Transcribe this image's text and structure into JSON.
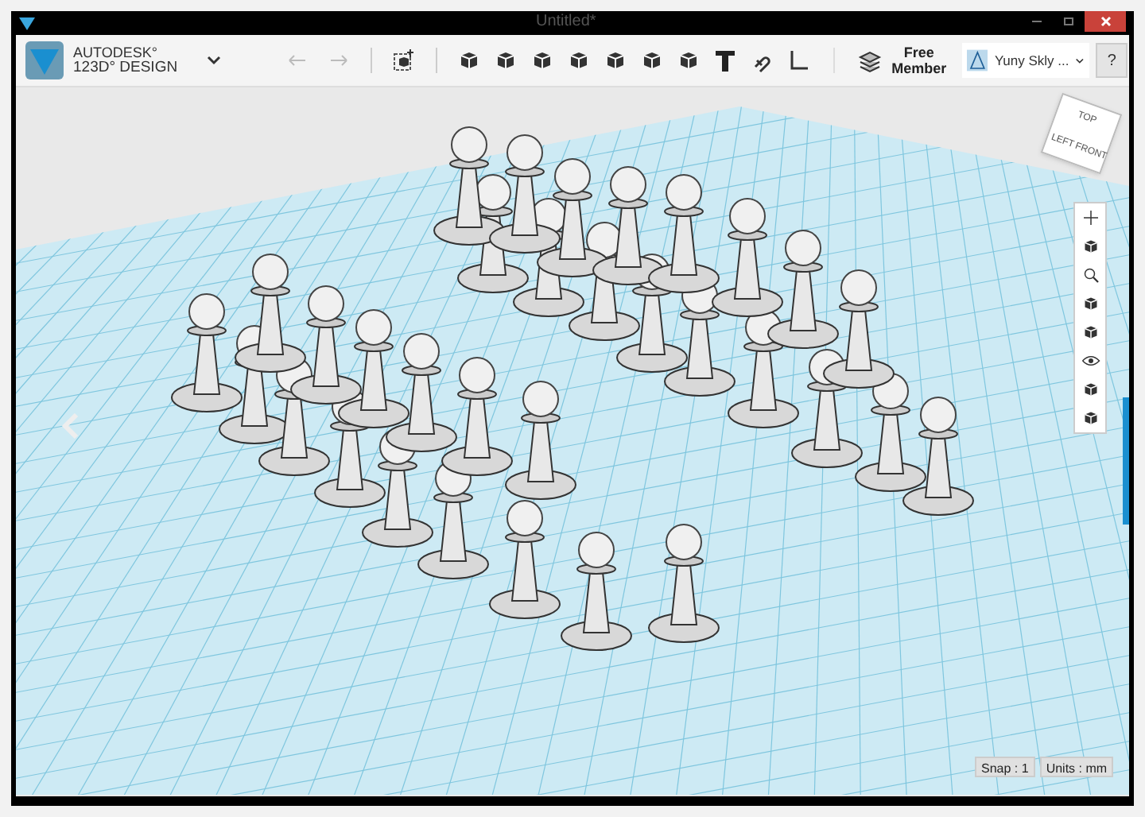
{
  "window": {
    "title": "Untitled*"
  },
  "brand": {
    "line_1": "AUTODESK°",
    "line_2": "123D° DESIGN"
  },
  "account": {
    "plan_line_1": "Free",
    "plan_line_2": "Member",
    "user": "Yuny Skly ...",
    "help": "?"
  },
  "view_cube": {
    "faces": [
      "TOP",
      "LEFT",
      "FRONT"
    ]
  },
  "status_bar": {
    "snap": "Snap : 1",
    "units": "Units : mm"
  }
}
